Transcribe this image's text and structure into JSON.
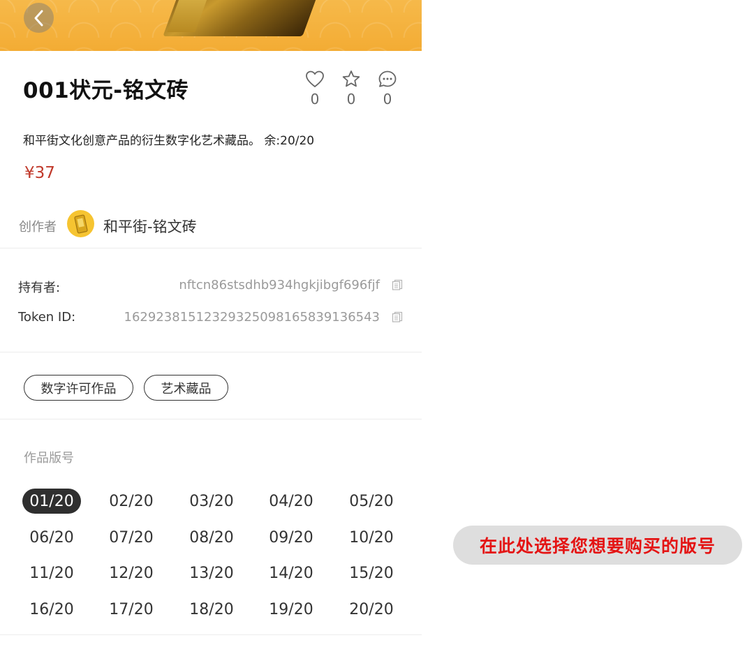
{
  "header": {
    "back_icon": "chevron-left-icon"
  },
  "product": {
    "title": "001状元-铭文砖",
    "description": "和平街文化创意产品的衍生数字化艺术藏品。 余:20/20",
    "price": "¥37"
  },
  "stats": [
    {
      "icon": "heart-icon",
      "count": "0"
    },
    {
      "icon": "star-icon",
      "count": "0"
    },
    {
      "icon": "comment-icon",
      "count": "0"
    }
  ],
  "creator": {
    "label": "创作者",
    "name": "和平街-铭文砖",
    "avatar_color": "#f6c431"
  },
  "ownership": {
    "holder_label": "持有者:",
    "holder_value": "nftcn86stsdhb934hgkjibgf696fjf",
    "token_label": "Token ID:",
    "token_value": "16292381512329325098165839136543"
  },
  "tags": [
    "数字许可作品",
    "艺术藏品"
  ],
  "editions": {
    "label": "作品版号",
    "selected": "01/20",
    "items": [
      "01/20",
      "02/20",
      "03/20",
      "04/20",
      "05/20",
      "06/20",
      "07/20",
      "08/20",
      "09/20",
      "10/20",
      "11/20",
      "12/20",
      "13/20",
      "14/20",
      "15/20",
      "16/20",
      "17/20",
      "18/20",
      "19/20",
      "20/20"
    ]
  },
  "hint": {
    "text": "在此处选择您想要购买的版号"
  },
  "colors": {
    "price": "#c0392b",
    "banner": "#f3ac34",
    "hint_text": "#e41414",
    "selected_edition": "#2f2f2f"
  }
}
